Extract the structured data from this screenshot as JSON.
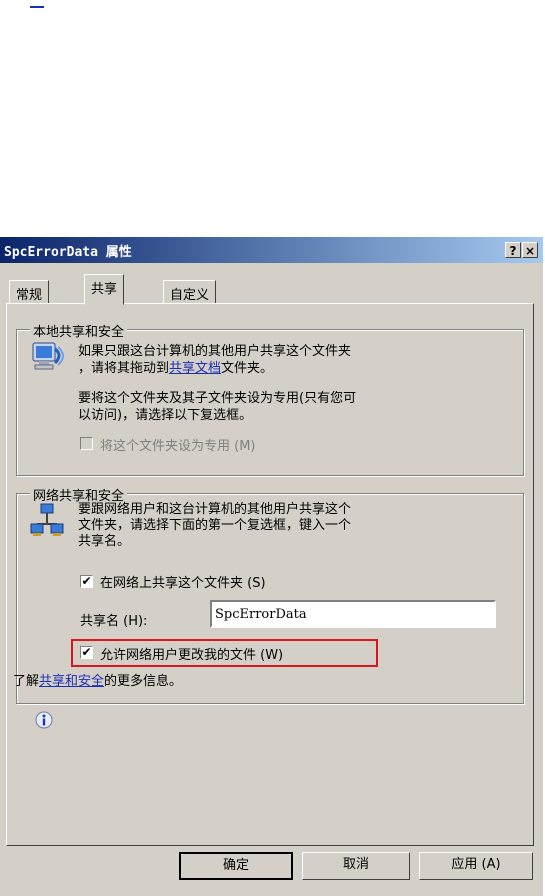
{
  "window": {
    "title": "SpcErrorData 属性",
    "help_btn": "?",
    "close_btn": "×"
  },
  "tabs": [
    {
      "label": "常规"
    },
    {
      "label": "共享"
    },
    {
      "label": "自定义"
    }
  ],
  "local": {
    "legend": "本地共享和安全",
    "p1_a": "如果只跟这台计算机的其他用户共享这个文件夹",
    "p1_b": "，请将其拖动到",
    "p1_link": "共享文档",
    "p1_c": "文件夹。",
    "p2_a": "要将这个文件夹及其子文件夹设为专用(只有您可",
    "p2_b": "以访问)，请选择以下复选框。",
    "private_checkbox": "将这个文件夹设为专用 (M)"
  },
  "network": {
    "legend": "网络共享和安全",
    "p_a": "要跟网络用户和这台计算机的其他用户共享这个",
    "p_b": "文件夹，请选择下面的第一个复选框，键入一个",
    "p_c": "共享名。",
    "share_checkbox": "在网络上共享这个文件夹 (S)",
    "share_name_label": "共享名 (H):",
    "share_name_value": "SpcErrorData",
    "allow_change_checkbox": "允许网络用户更改我的文件 (W)"
  },
  "learn": {
    "pre": "了解",
    "link": "共享和安全",
    "post": "的更多信息。"
  },
  "buttons": {
    "ok": "确定",
    "cancel": "取消",
    "apply": "应用 (A)"
  }
}
